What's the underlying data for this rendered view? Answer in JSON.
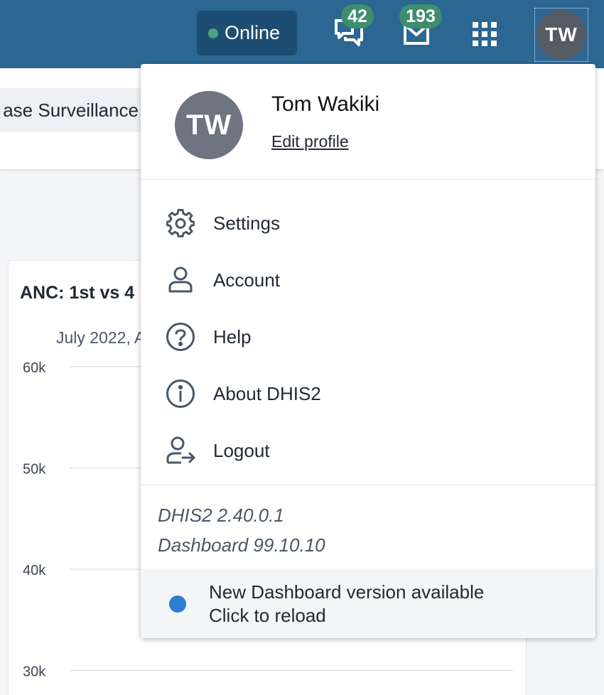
{
  "header": {
    "status": {
      "label": "Online",
      "color": "#46a77a"
    },
    "interpretations": {
      "icon": "interpretations-icon",
      "badge": "42"
    },
    "messages": {
      "icon": "messages-icon",
      "badge": "193"
    },
    "apps": {
      "icon": "apps-grid-icon"
    },
    "profile": {
      "initials": "TW"
    },
    "colors": {
      "bar": "#2c6693",
      "badge": "#3e8e6e"
    }
  },
  "background": {
    "dashboard_chip": "ase Surveillance",
    "chart": {
      "title_fragment": "ANC: 1st vs 4",
      "subtitle_fragment": "July 2022, A"
    }
  },
  "chart_data": {
    "type": "line",
    "title": "ANC: 1st vs 4",
    "subtitle": "July 2022, A",
    "y_ticks": [
      "60k",
      "50k",
      "40k",
      "30k"
    ],
    "y_values": [
      60000,
      50000,
      40000,
      30000
    ],
    "grid": true
  },
  "menu": {
    "avatar_initials": "TW",
    "name": "Tom Wakiki",
    "edit_profile": "Edit profile",
    "items": [
      {
        "label": "Settings",
        "icon": "settings-gear-icon"
      },
      {
        "label": "Account",
        "icon": "account-person-icon"
      },
      {
        "label": "Help",
        "icon": "help-question-icon"
      },
      {
        "label": "About DHIS2",
        "icon": "info-icon"
      },
      {
        "label": "Logout",
        "icon": "logout-icon"
      }
    ],
    "versions": [
      "DHIS2 2.40.0.1",
      "Dashboard 99.10.10"
    ],
    "update": {
      "line1": "New Dashboard version available",
      "line2": "Click to reload",
      "dot_color": "#2d7dd2"
    }
  }
}
